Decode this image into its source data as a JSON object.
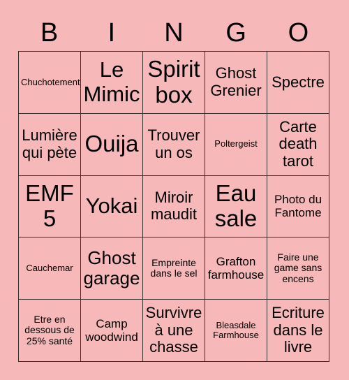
{
  "card": {
    "headers": [
      "B",
      "I",
      "N",
      "G",
      "O"
    ],
    "colors": {
      "background": "#f6b8b8",
      "cell_background": "#f6b8b8",
      "grid_line": "#3b3030",
      "text": "#000000"
    },
    "rows": [
      [
        {
          "text": "Chuchotement",
          "size": "xxs"
        },
        {
          "text": "Le Mimic",
          "size": "xl"
        },
        {
          "text": "Spirit box",
          "size": "xxl"
        },
        {
          "text": "Ghost Grenier",
          "size": "md"
        },
        {
          "text": "Spectre",
          "size": "md"
        }
      ],
      [
        {
          "text": "Lumière qui pète",
          "size": "md"
        },
        {
          "text": "Ouija",
          "size": "xxl"
        },
        {
          "text": "Trouver un os",
          "size": "md"
        },
        {
          "text": "Poltergeist",
          "size": "xxs"
        },
        {
          "text": "Carte death tarot",
          "size": "md"
        }
      ],
      [
        {
          "text": "EMF 5",
          "size": "xxl"
        },
        {
          "text": "Yokai",
          "size": "xl"
        },
        {
          "text": "Miroir maudit",
          "size": "md"
        },
        {
          "text": "Eau sale",
          "size": "xxl"
        },
        {
          "text": "Photo du Fantome",
          "size": "sm"
        }
      ],
      [
        {
          "text": "Cauchemar",
          "size": "xxs"
        },
        {
          "text": "Ghost garage",
          "size": "lg"
        },
        {
          "text": "Empreinte dans le sel",
          "size": "xs"
        },
        {
          "text": "Grafton farmhouse",
          "size": "sm"
        },
        {
          "text": "Faire une game sans encens",
          "size": "xs"
        }
      ],
      [
        {
          "text": "Etre en dessous de 25% santé",
          "size": "xs"
        },
        {
          "text": "Camp woodwind",
          "size": "sm"
        },
        {
          "text": "Survivre à une chasse",
          "size": "md"
        },
        {
          "text": "Bleasdale Farmhouse",
          "size": "xxs"
        },
        {
          "text": "Ecriture dans le livre",
          "size": "md"
        }
      ]
    ]
  }
}
